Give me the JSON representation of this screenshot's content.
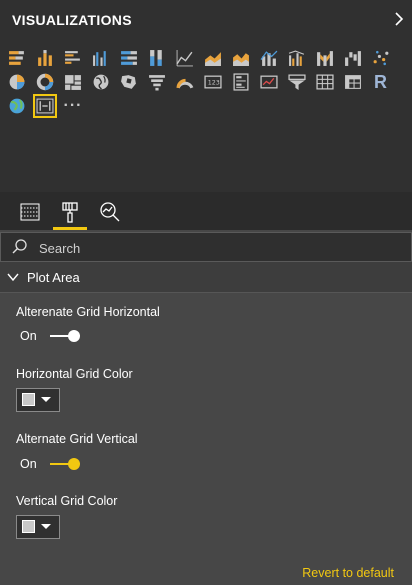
{
  "header": {
    "title": "VISUALIZATIONS",
    "collapse_icon": "chevron-right-icon"
  },
  "visuals": [
    {
      "name": "stacked-bar-chart-icon"
    },
    {
      "name": "stacked-column-chart-icon"
    },
    {
      "name": "clustered-bar-chart-icon"
    },
    {
      "name": "clustered-column-chart-icon"
    },
    {
      "name": "100-stacked-bar-chart-icon"
    },
    {
      "name": "100-stacked-column-chart-icon"
    },
    {
      "name": "line-chart-icon"
    },
    {
      "name": "area-chart-icon"
    },
    {
      "name": "stacked-area-chart-icon"
    },
    {
      "name": "line-and-stacked-column-icon"
    },
    {
      "name": "line-and-clustered-column-icon"
    },
    {
      "name": "ribbon-chart-icon"
    },
    {
      "name": "waterfall-chart-icon"
    },
    {
      "name": "scatter-chart-icon"
    },
    {
      "name": "pie-chart-icon"
    },
    {
      "name": "donut-chart-icon"
    },
    {
      "name": "treemap-icon"
    },
    {
      "name": "map-icon"
    },
    {
      "name": "filled-map-icon"
    },
    {
      "name": "funnel-icon"
    },
    {
      "name": "gauge-icon"
    },
    {
      "name": "card-icon"
    },
    {
      "name": "multi-row-card-icon"
    },
    {
      "name": "kpi-icon"
    },
    {
      "name": "slicer-icon"
    },
    {
      "name": "table-icon"
    },
    {
      "name": "matrix-icon"
    },
    {
      "name": "r-script-visual-icon",
      "text": "R"
    },
    {
      "name": "globe-map-icon"
    },
    {
      "name": "custom-visual-selected-icon",
      "selected": true
    },
    {
      "name": "more-visuals-icon",
      "text": "···"
    }
  ],
  "tabs": [
    {
      "name": "fields-tab-icon"
    },
    {
      "name": "format-paint-roller-tab-icon",
      "active": true
    },
    {
      "name": "analytics-tab-icon"
    }
  ],
  "search": {
    "placeholder": "Search",
    "icon": "search-icon"
  },
  "section": {
    "title": "Plot Area",
    "icon": "chevron-down-icon"
  },
  "props": {
    "alt_grid_horizontal": {
      "label": "Alterenate Grid Horizontal",
      "state": "On",
      "color": "#ffffff"
    },
    "horizontal_grid_color": {
      "label": "Horizontal Grid Color",
      "swatch": "#c8c8c8"
    },
    "alt_grid_vertical": {
      "label": "Alternate Grid Vertical",
      "state": "On",
      "color": "#f2c811"
    },
    "vertical_grid_color": {
      "label": "Vertical Grid Color",
      "swatch": "#c8c8c8"
    }
  },
  "revert": {
    "label": "Revert to default",
    "color": "#f2c811"
  },
  "colors": {
    "accent": "#f2c811",
    "pane_bg": "#303030",
    "format_bg": "#474747"
  }
}
